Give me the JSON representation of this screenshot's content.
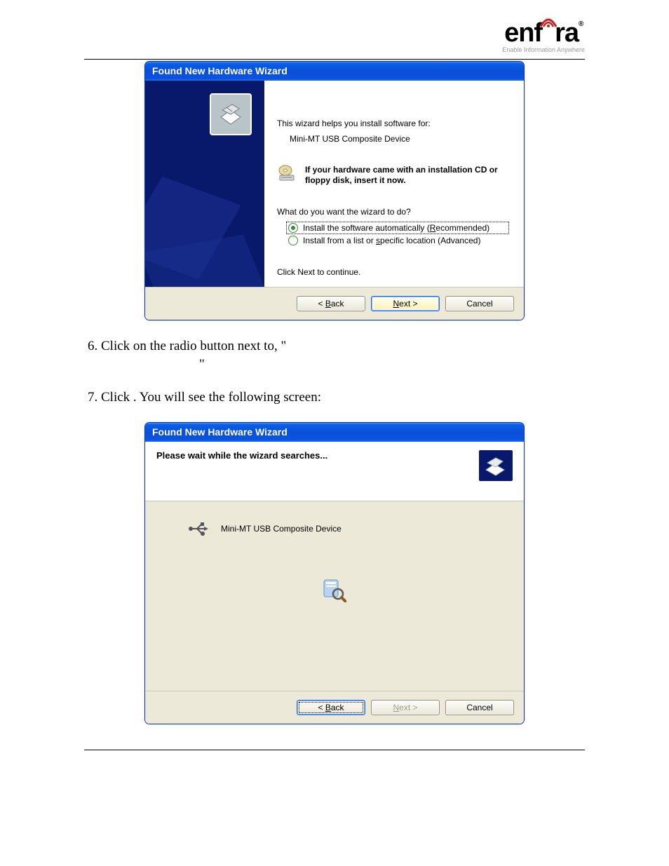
{
  "logo": {
    "name": "enfora",
    "registered": "®",
    "tagline": "Enable Information Anywhere"
  },
  "dialog1": {
    "title": "Found New Hardware Wizard",
    "intro": "This wizard helps you install software for:",
    "device": "Mini-MT USB Composite Device",
    "cd_hint": "If your hardware came with an installation CD or floppy disk, insert it now.",
    "prompt": "What do you want the wizard to do?",
    "opt_auto": "Install the software automatically (Recommended)",
    "opt_list": "Install from a list or specific location (Advanced)",
    "click_next": "Click Next to continue.",
    "back": "< Back",
    "next": "Next >",
    "cancel": "Cancel"
  },
  "step6": {
    "prefix": "Click on the radio button next to, \"",
    "suffix": "\""
  },
  "step7": {
    "prefix": "Click ",
    "mid": ".  You will see the following screen:"
  },
  "dialog2": {
    "title": "Found New Hardware Wizard",
    "header": "Please wait while the wizard searches...",
    "device": "Mini-MT USB Composite Device",
    "back": "< Back",
    "next": "Next >",
    "cancel": "Cancel"
  }
}
